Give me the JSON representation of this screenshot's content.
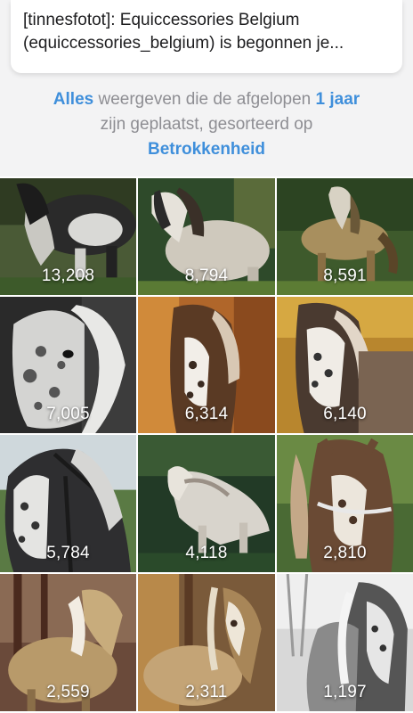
{
  "notification": {
    "line1": "[tinnesfotot]: Equiccessories Belgium",
    "line2": "(equiccessories_belgium) is begonnen je..."
  },
  "filter": {
    "all_link": "Alles",
    "text1": " weergeven die de afgelopen ",
    "period_link": "1 jaar",
    "text2": "zijn geplaatst, gesorteerd op",
    "sort_link": "Betrokkenheid"
  },
  "photos": [
    {
      "count": "13,208",
      "icon": "horse-photo"
    },
    {
      "count": "8,794",
      "icon": "horse-photo"
    },
    {
      "count": "8,591",
      "icon": "horse-photo"
    },
    {
      "count": "7,005",
      "icon": "horse-photo"
    },
    {
      "count": "6,314",
      "icon": "horse-photo"
    },
    {
      "count": "6,140",
      "icon": "horse-photo"
    },
    {
      "count": "5,784",
      "icon": "horse-photo"
    },
    {
      "count": "4,118",
      "icon": "horse-photo"
    },
    {
      "count": "2,810",
      "icon": "horse-photo"
    },
    {
      "count": "2,559",
      "icon": "horse-photo"
    },
    {
      "count": "2,311",
      "icon": "horse-photo"
    },
    {
      "count": "1,197",
      "icon": "horse-photo"
    }
  ],
  "colors": {
    "link": "#3f8fdb",
    "muted_text": "#8e8e93",
    "header_bg": "#f3f3f4"
  }
}
